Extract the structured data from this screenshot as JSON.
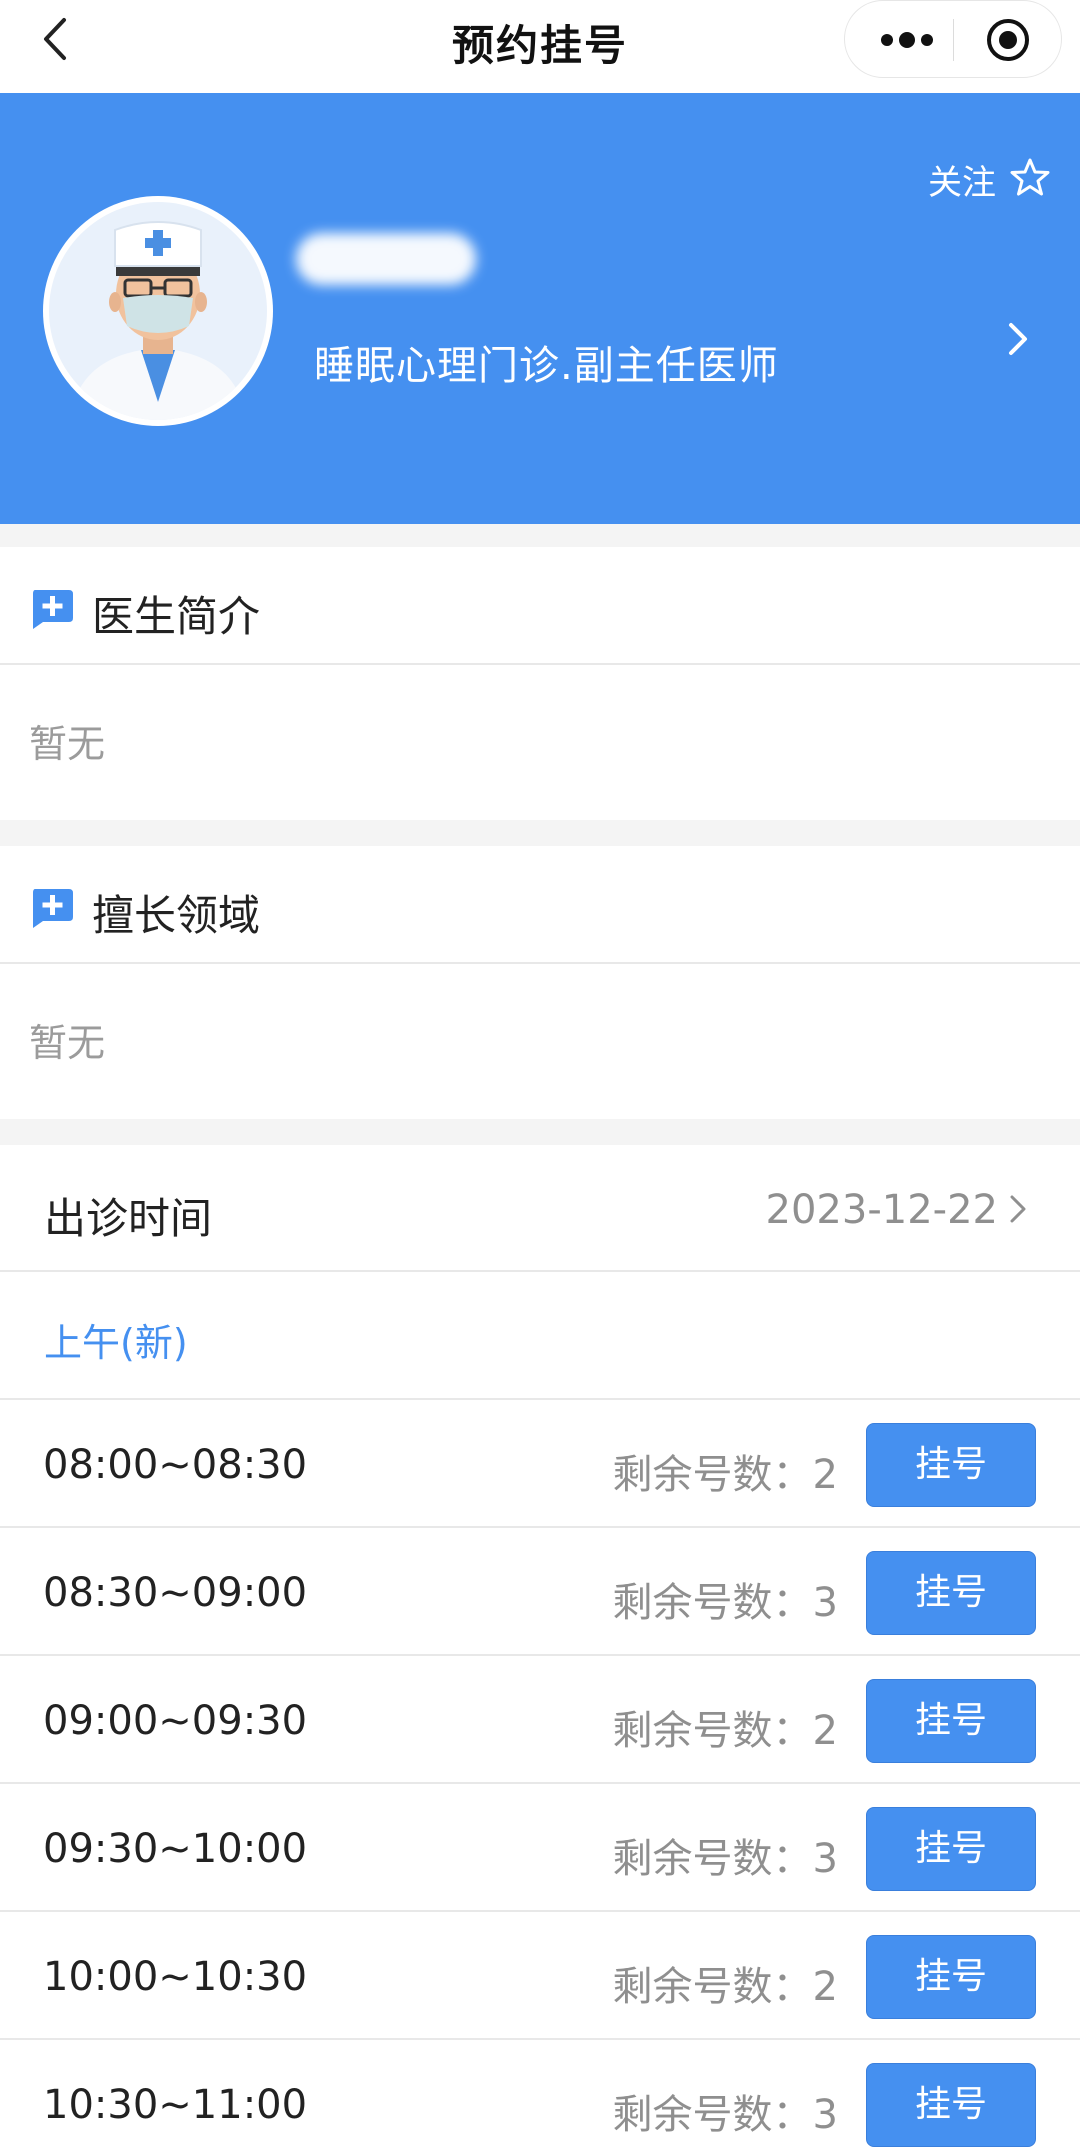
{
  "nav": {
    "title": "预约挂号"
  },
  "doctor": {
    "follow_label": "关注",
    "department_title": "睡眠心理门诊.副主任医师"
  },
  "intro": {
    "title": "医生简介",
    "content": "暂无"
  },
  "specialty": {
    "title": "擅长领域",
    "content": "暂无"
  },
  "schedule": {
    "title": "出诊时间",
    "date": "2023-12-22",
    "period_label": "上午(新)",
    "remaining_prefix": "剩余号数：",
    "slots": [
      {
        "time": "08:00~08:30",
        "remaining": "2",
        "button": "挂号"
      },
      {
        "time": "08:30~09:00",
        "remaining": "3",
        "button": "挂号"
      },
      {
        "time": "09:00~09:30",
        "remaining": "2",
        "button": "挂号"
      },
      {
        "time": "09:30~10:00",
        "remaining": "3",
        "button": "挂号"
      },
      {
        "time": "10:00~10:30",
        "remaining": "2",
        "button": "挂号"
      },
      {
        "time": "10:30~11:00",
        "remaining": "3",
        "button": "挂号"
      }
    ]
  },
  "colors": {
    "primary": "#4590f0",
    "muted_text": "#8f8f8f",
    "background": "#f4f4f4"
  },
  "icons": [
    "back-icon",
    "more-icon",
    "target-icon",
    "star-icon",
    "chevron-right-icon",
    "medical-plus-icon",
    "doctor-avatar"
  ]
}
